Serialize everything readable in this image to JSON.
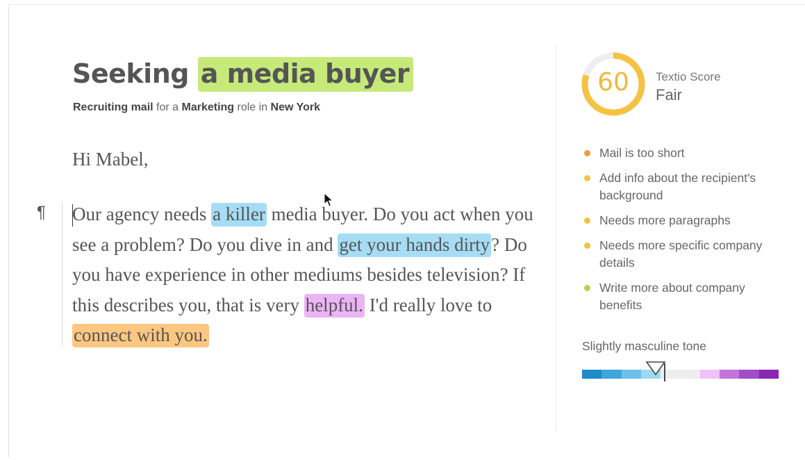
{
  "document": {
    "title_prefix": "Seeking",
    "title_highlight": "a media buyer",
    "subtitle": {
      "part1": "Recruiting mail",
      "part2": " for a ",
      "part3": "Marketing",
      "part4": " role in ",
      "part5": "New York"
    },
    "greeting": "Hi Mabel,",
    "pilcrow": "¶",
    "body": [
      {
        "text": "Our agency needs ",
        "hl": ""
      },
      {
        "text": "a killer",
        "hl": "blue"
      },
      {
        "text": " media buyer. Do you act when you see a problem? Do you dive in and ",
        "hl": ""
      },
      {
        "text": "get your hands dirty",
        "hl": "blue"
      },
      {
        "text": "? Do you have experience in other mediums besides television? If this describes you, that is very ",
        "hl": ""
      },
      {
        "text": "helpful.",
        "hl": "purple"
      },
      {
        "text": " I'd really love to ",
        "hl": ""
      },
      {
        "text": "connect with you.",
        "hl": "orange"
      }
    ]
  },
  "score": {
    "value": "60",
    "label": "Textio Score",
    "rating": "Fair",
    "max": 100,
    "color": "#f5c242",
    "track_color": "#eeeeee"
  },
  "suggestions": [
    {
      "text": "Mail is too short",
      "color": "#f29a3d"
    },
    {
      "text": "Add info about the recipient's background",
      "color": "#f5c242"
    },
    {
      "text": "Needs more paragraphs",
      "color": "#f5c242"
    },
    {
      "text": "Needs more specific company details",
      "color": "#f5c242"
    },
    {
      "text": "Write more about company benefits",
      "color": "#a8d84a"
    }
  ],
  "tone": {
    "label": "Slightly masculine tone",
    "position": 0.42,
    "segments": [
      "#1e8bc9",
      "#3fa6dc",
      "#6cc1ea",
      "#9fd8f2",
      "#eeeeee",
      "#eeeeee",
      "#eec4f6",
      "#c274dc",
      "#a14fc6",
      "#8a25b4"
    ]
  },
  "highlight_colors": {
    "title": "#c5ea7a",
    "blue": "#a6dcf4",
    "purple": "#ecb3f6",
    "orange": "#fdc781"
  },
  "icons": {
    "cursor": "mouse-pointer-icon",
    "tone_marker": "triangle-marker-icon"
  }
}
